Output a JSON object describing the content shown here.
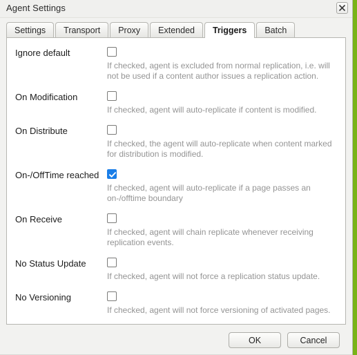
{
  "window": {
    "title": "Agent Settings",
    "close_icon": "close-icon",
    "accent_checked_color": "#1a7ee8",
    "page_background_color": "#7ab317"
  },
  "tabs": [
    {
      "label": "Settings",
      "active": false
    },
    {
      "label": "Transport",
      "active": false
    },
    {
      "label": "Proxy",
      "active": false
    },
    {
      "label": "Extended",
      "active": false
    },
    {
      "label": "Triggers",
      "active": true
    },
    {
      "label": "Batch",
      "active": false
    }
  ],
  "form": {
    "rows": [
      {
        "label": "Ignore default",
        "checked": false,
        "description": "If checked, agent is excluded from normal replication, i.e. will not be used if a content author issues a replication action."
      },
      {
        "label": "On Modification",
        "checked": false,
        "description": "If checked, agent will auto-replicate if content is modified."
      },
      {
        "label": "On Distribute",
        "checked": false,
        "description": "If checked, the agent will auto-replicate when content marked for distribution is modified."
      },
      {
        "label": "On-/OffTime reached",
        "checked": true,
        "description": "If checked, agent will auto-replicate if a page passes an on-/offtime boundary"
      },
      {
        "label": "On Receive",
        "checked": false,
        "description": "If checked, agent will chain replicate whenever receiving replication events."
      },
      {
        "label": "No Status Update",
        "checked": false,
        "description": "If checked, agent will not force a replication status update."
      },
      {
        "label": "No Versioning",
        "checked": false,
        "description": "If checked, agent will not force versioning of activated pages."
      }
    ]
  },
  "footer": {
    "ok_label": "OK",
    "cancel_label": "Cancel"
  }
}
